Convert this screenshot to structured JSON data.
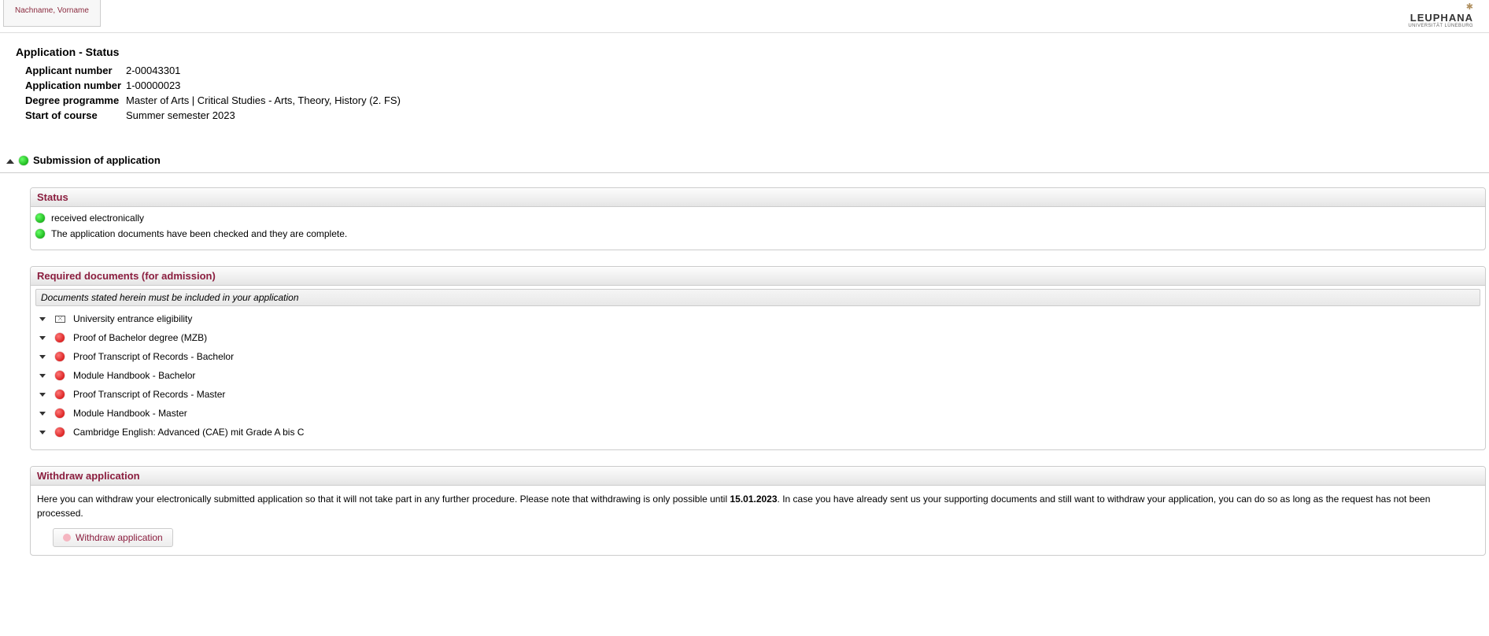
{
  "header": {
    "user_tab": "Nachname, Vorname",
    "logo_text": "LEUPHANA",
    "logo_sub": "UNIVERSITÄT LÜNEBURG"
  },
  "page": {
    "title": "Application - Status",
    "info": {
      "applicant_number_label": "Applicant number",
      "applicant_number_value": "2-00043301",
      "application_number_label": "Application number",
      "application_number_value": "1-00000023",
      "degree_programme_label": "Degree programme",
      "degree_programme_value": "Master of Arts | Critical Studies - Arts, Theory, History (2. FS)",
      "start_of_course_label": "Start of course",
      "start_of_course_value": "Summer semester 2023"
    }
  },
  "submission": {
    "section_title": "Submission of application",
    "status_panel_title": "Status",
    "status_items": [
      {
        "text": "received electronically"
      },
      {
        "text": "The application documents have been checked and they are complete."
      }
    ],
    "docs_panel_title": "Required documents (for admission)",
    "docs_subheader": "Documents stated herein must be included in your application",
    "docs": [
      {
        "icon": "envelope",
        "label": "University entrance eligibility"
      },
      {
        "icon": "dot-red",
        "label": "Proof of Bachelor degree (MZB)"
      },
      {
        "icon": "dot-red",
        "label": "Proof Transcript of Records - Bachelor"
      },
      {
        "icon": "dot-red",
        "label": "Module Handbook - Bachelor"
      },
      {
        "icon": "dot-red",
        "label": "Proof Transcript of Records - Master"
      },
      {
        "icon": "dot-red",
        "label": "Module Handbook - Master"
      },
      {
        "icon": "dot-red",
        "label": "Cambridge English: Advanced (CAE) mit Grade A bis C"
      }
    ],
    "withdraw_panel_title": "Withdraw application",
    "withdraw_text_pre": "Here you can withdraw your electronically submitted application so that it will not take part in any further procedure. Please note that withdrawing is only possible until ",
    "withdraw_deadline": "15.01.2023",
    "withdraw_text_post": ". In case you have already sent us your supporting documents and still want to withdraw your application, you can do so as long as the request has not been processed.",
    "withdraw_button_label": "Withdraw application"
  }
}
